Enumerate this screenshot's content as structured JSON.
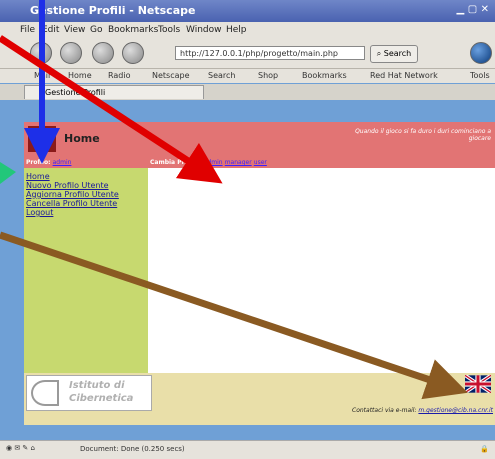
{
  "browser": {
    "title": "Gestione Profili - Netscape",
    "menu": [
      "File",
      "Edit",
      "View",
      "Go",
      "Bookmarks",
      "Tools",
      "Window",
      "Help"
    ],
    "url": "http://127.0.0.1/php/progetto/main.php",
    "search_label": "Search",
    "bookmarks": [
      "Mail",
      "Home",
      "Radio",
      "Netscape",
      "Search",
      "Shop",
      "Bookmarks",
      "Red Hat Network",
      "Tools"
    ],
    "tab_title": "Gestione Profili",
    "status": "Document: Done (0.250 secs)"
  },
  "page": {
    "home_label": "Home",
    "motto": "Quando il gioco si fa duro i duri cominciano a giocare",
    "profile_label": "Profilo:",
    "profile_value": "admin",
    "switch_label": "Cambia Profilo:",
    "switch_options": [
      "admin",
      "manager",
      "user"
    ],
    "nav": [
      "Home",
      "Nuovo Profilo Utente",
      "Aggiorna Profilo Utente",
      "Cancella Profilo Utente",
      "Logout"
    ],
    "institute": [
      "Istituto di",
      "Cibernetica"
    ],
    "contact_text": "Contattaci via e-mail:",
    "contact_email": "m.gestione@cib.na.cnr.it"
  }
}
